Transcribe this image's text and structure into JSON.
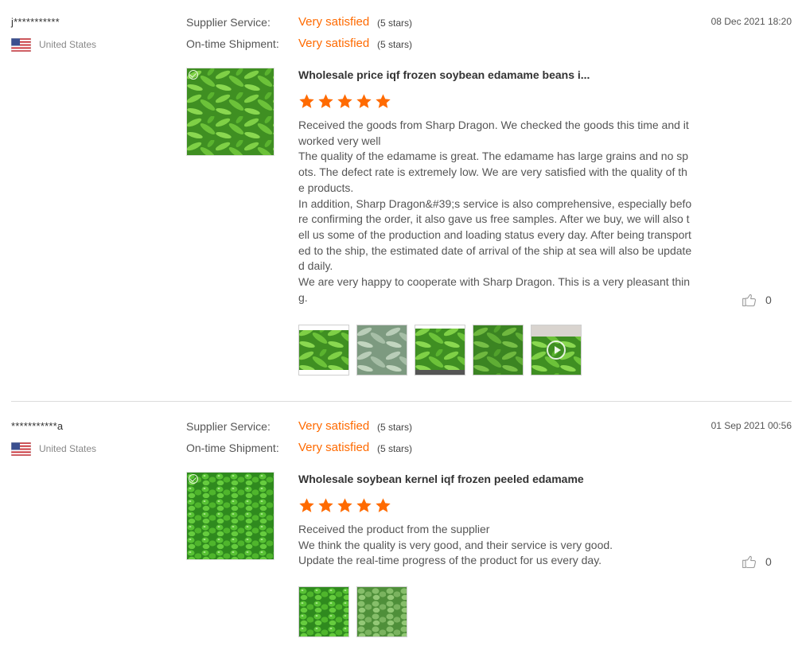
{
  "colors": {
    "accent": "#ff6a00",
    "star": "#ff6a00"
  },
  "icons": {
    "flag": "us-flag-icon",
    "like": "thumbs-up-icon",
    "verified": "check-circle-icon",
    "play": "play-icon"
  },
  "reviews": [
    {
      "buyer": "j***********",
      "country": "United States",
      "date": "08 Dec 2021 18:20",
      "supplier_service_label": "Supplier Service:",
      "supplier_service_value": "Very satisfied",
      "supplier_service_stars": "(5 stars)",
      "shipment_label": "On-time Shipment:",
      "shipment_value": "Very satisfied",
      "shipment_stars": "(5 stars)",
      "product_title": "Wholesale price iqf frozen soybean edamame beans i...",
      "rating": 5,
      "text_lines": [
        "Received the goods from Sharp Dragon. We checked the goods this time and it worked very well",
        "The quality of the edamame is great. The edamame has large grains and no spots. The defect rate is extremely low. We are very satisfied with the quality of the products.",
        "In addition, Sharp Dragon&#39;s service is also comprehensive, especially before confirming the order, it also gave us free samples. After we buy, we will also tell us some of the production and loading status every day. After being transported to the ship, the estimated date of arrival of the ship at sea will also be updated daily.",
        "We are very happy to cooperate with Sharp Dragon. This is a very pleasant thing."
      ],
      "likes": "0",
      "thumbnails": 5,
      "video_thumbnail": 5
    },
    {
      "buyer": "***********a",
      "country": "United States",
      "date": "01 Sep 2021 00:56",
      "supplier_service_label": "Supplier Service:",
      "supplier_service_value": "Very satisfied",
      "supplier_service_stars": "(5 stars)",
      "shipment_label": "On-time Shipment:",
      "shipment_value": "Very satisfied",
      "shipment_stars": "(5 stars)",
      "product_title": "Wholesale soybean kernel iqf frozen peeled edamame",
      "rating": 5,
      "text_lines": [
        "Received the product from the supplier",
        "We think the quality is very good, and their service is very good.",
        "Update the real-time progress of the product for us every day."
      ],
      "likes": "0",
      "thumbnails": 2
    }
  ]
}
